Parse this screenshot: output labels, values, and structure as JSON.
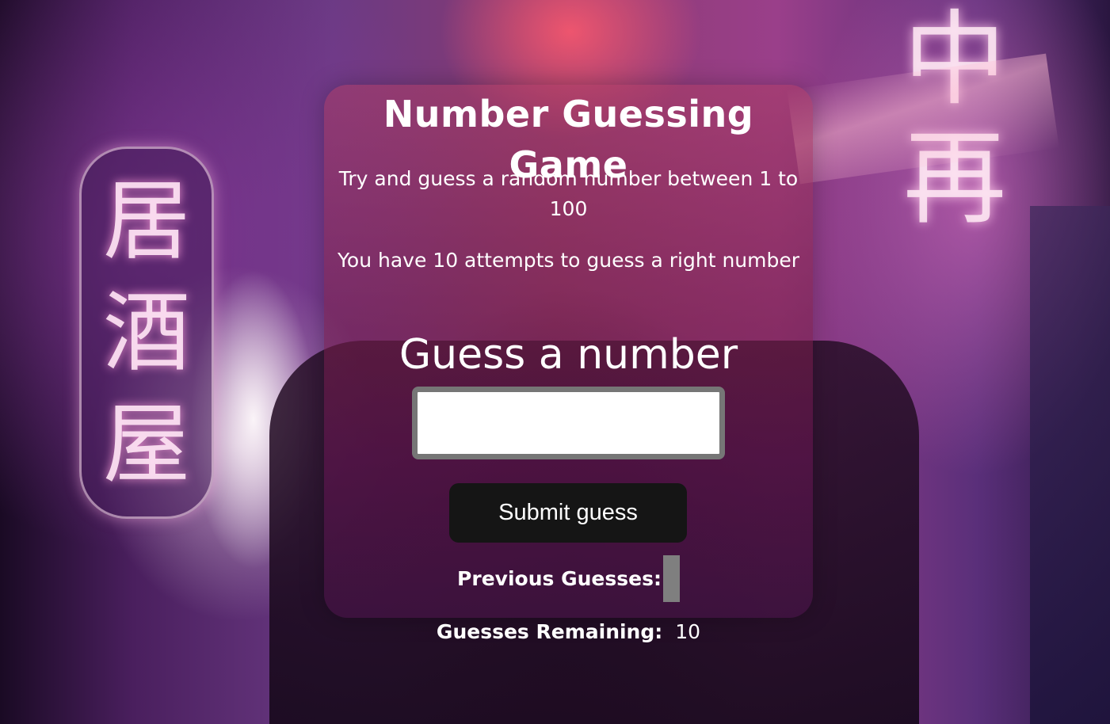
{
  "game": {
    "title": "Number Guessing Game",
    "instruction": "Try and guess a random number between 1 to 100",
    "attempts_note": "You have 10 attempts to guess a right number",
    "guess_label": "Guess a number",
    "input_value": "",
    "submit_label": "Submit guess",
    "previous_guesses_label": "Previous Guesses:",
    "previous_guesses": "",
    "remaining_label": "Guesses Remaining:",
    "remaining_value": "10"
  },
  "colors": {
    "card_tint": "#8a2a5a",
    "button_bg": "#151515",
    "input_border": "#767676",
    "prev_box": "#7f7f7f",
    "text": "#ffffff"
  }
}
